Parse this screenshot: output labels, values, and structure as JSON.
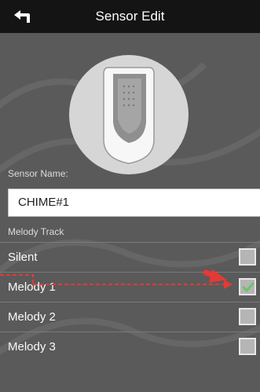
{
  "header": {
    "title": "Sensor Edit",
    "back_icon": "back-arrow-icon"
  },
  "device": {
    "icon": "chime-device-icon"
  },
  "sensor_name": {
    "label": "Sensor Name:",
    "value": "CHIME#1"
  },
  "melody_track": {
    "label": "Melody Track",
    "options": [
      {
        "label": "Silent",
        "checked": false
      },
      {
        "label": "Melody 1",
        "checked": true
      },
      {
        "label": "Melody 2",
        "checked": false
      },
      {
        "label": "Melody 3",
        "checked": false
      }
    ]
  },
  "colors": {
    "header": "#141414",
    "background": "#5a5a5a",
    "check": "#6cc36a",
    "annotation": "#e53935"
  }
}
